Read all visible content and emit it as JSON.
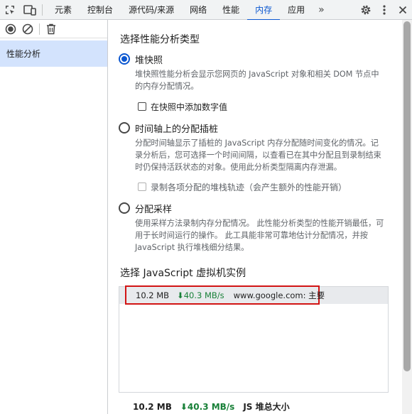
{
  "tabs": [
    {
      "label": "元素",
      "active": false
    },
    {
      "label": "控制台",
      "active": false
    },
    {
      "label": "源代码/来源",
      "active": false
    },
    {
      "label": "网络",
      "active": false
    },
    {
      "label": "性能",
      "active": false
    },
    {
      "label": "内存",
      "active": true
    },
    {
      "label": "应用",
      "active": false
    }
  ],
  "tab_more": "»",
  "icons": {
    "inspect": "inspect-element-icon",
    "device": "device-toggle-icon",
    "settings": "gear-icon",
    "menu": "vertical-dots-icon",
    "close": "close-icon",
    "record": "record-icon",
    "clear": "clear-icon",
    "delete": "trash-icon"
  },
  "sidebar": {
    "profiles_label": "性能分析"
  },
  "main": {
    "select_type_title": "选择性能分析类型",
    "options": [
      {
        "label": "堆快照",
        "selected": true,
        "description": "堆快照性能分析会显示您网页的 JavaScript 对象和相关 DOM 节点中的内存分配情况。",
        "checkbox_label": "在快照中添加数字值",
        "checkbox_checked": false,
        "checkbox_disabled": false
      },
      {
        "label": "时间轴上的分配插桩",
        "selected": false,
        "description": "分配时间轴显示了插桩的 JavaScript 内存分配随时间变化的情况。记录分析后，您可选择一个时间间隔，以查看已在其中分配且到录制结束时仍保持活跃状态的对象。使用此分析类型隔离内存泄漏。",
        "checkbox_label": "录制各项分配的堆栈轨迹（会产生额外的性能开销）",
        "checkbox_checked": false,
        "checkbox_disabled": true
      },
      {
        "label": "分配采样",
        "selected": false,
        "description": "使用采样方法录制内存分配情况。 此性能分析类型的性能开销最低，可用于长时间运行的操作。 此工具能非常可靠地估计分配情况，并按 JavaScript 执行堆栈细分结果。"
      }
    ],
    "vm_title": "选择 JavaScript 虚拟机实例",
    "vm_instances": [
      {
        "heap": "10.2 MB",
        "speed": "⬇40.3 MB/s",
        "name": "www.google.com: 主要"
      }
    ],
    "footer": {
      "heap": "10.2 MB",
      "speed": "⬇40.3 MB/s",
      "label": "JS 堆总大小"
    }
  },
  "colors": {
    "accent": "#0b57d0",
    "selected_bg": "#d3e3fd",
    "highlight_border": "#d21414",
    "speed_green": "#188038"
  }
}
